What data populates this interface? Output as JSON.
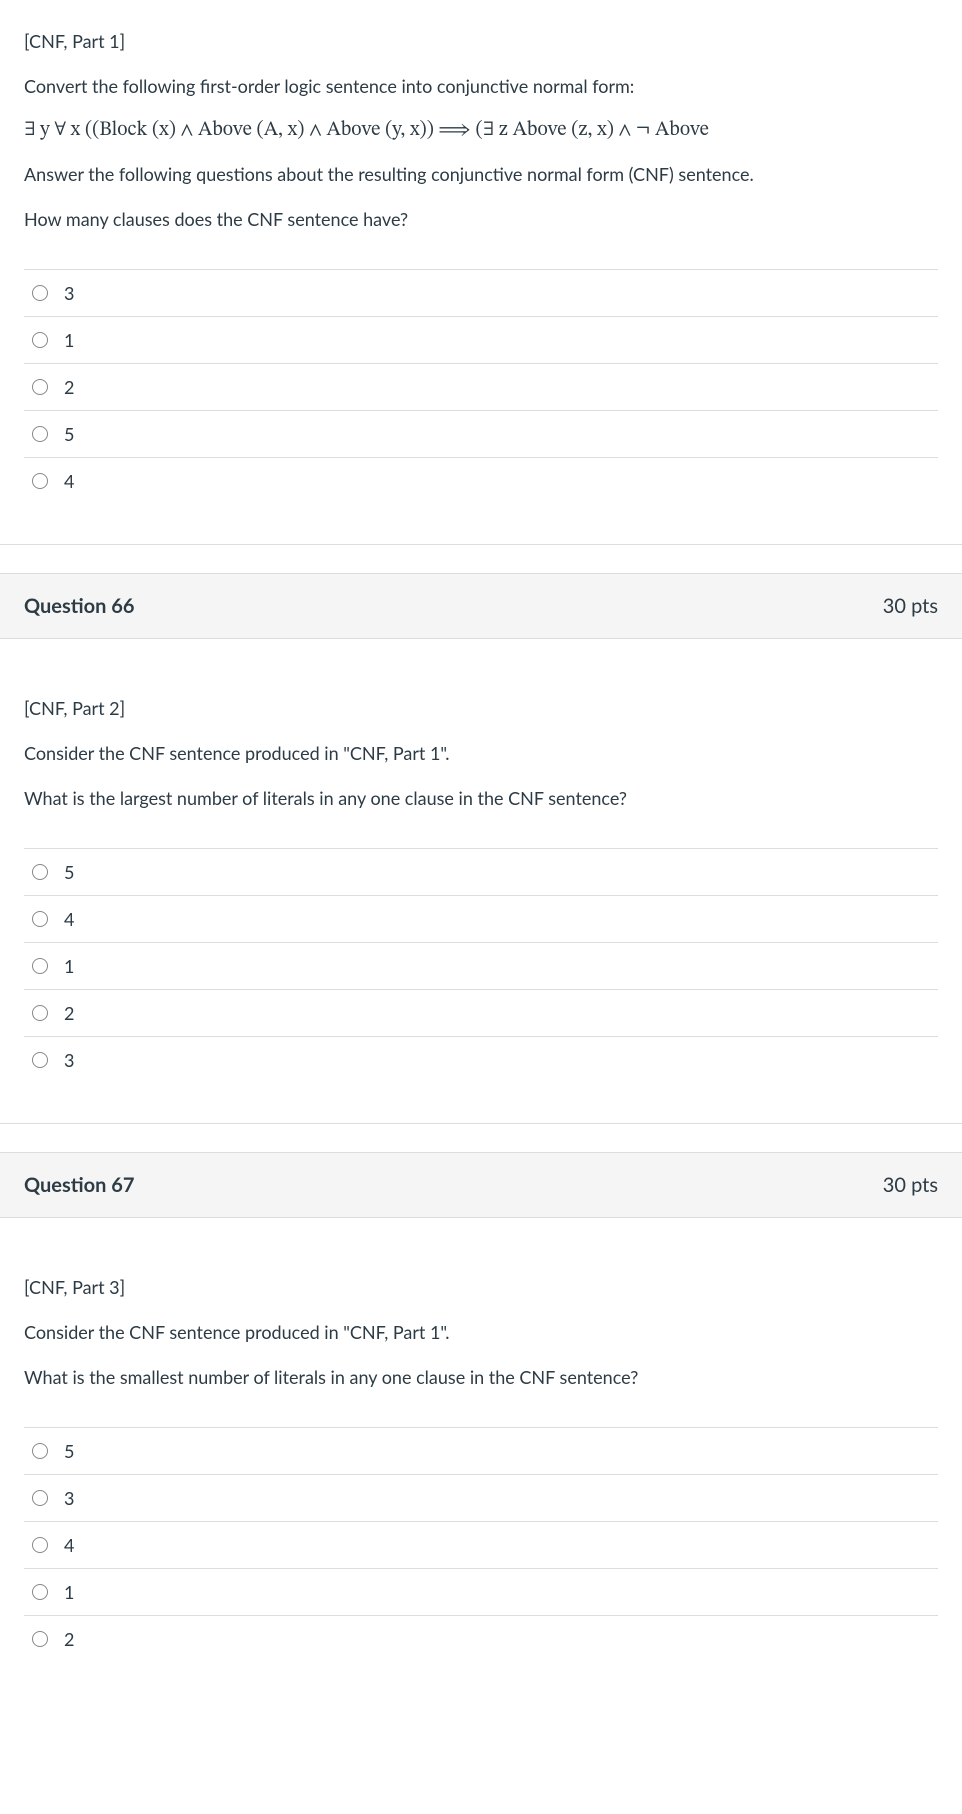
{
  "q65": {
    "part_label": "[CNF, Part 1]",
    "intro": "Convert the following first-order logic sentence into conjunctive normal form:",
    "formula": "∃ y ∀ x  ((Block (x)  ∧  Above (A,  x)  ∧  Above (y,  x))   ⟹   (∃ z Above (z,  x)  ∧  ¬ Above",
    "after_formula": "Answer the following questions about the resulting conjunctive normal form (CNF) sentence.",
    "prompt": "How many clauses does the CNF sentence have?",
    "options": [
      "3",
      "1",
      "2",
      "5",
      "4"
    ]
  },
  "q66": {
    "header_title": "Question 66",
    "header_pts": "30 pts",
    "part_label": "[CNF, Part 2]",
    "intro": "Consider the CNF sentence produced in \"CNF, Part 1\".",
    "prompt": "What is the largest number of literals in any one clause in the CNF sentence?",
    "options": [
      "5",
      "4",
      "1",
      "2",
      "3"
    ]
  },
  "q67": {
    "header_title": "Question 67",
    "header_pts": "30 pts",
    "part_label": "[CNF, Part 3]",
    "intro": "Consider the CNF sentence produced in \"CNF, Part 1\".",
    "prompt": "What is the smallest number of literals in any one clause in the CNF sentence?",
    "options": [
      "5",
      "3",
      "4",
      "1",
      "2"
    ]
  }
}
